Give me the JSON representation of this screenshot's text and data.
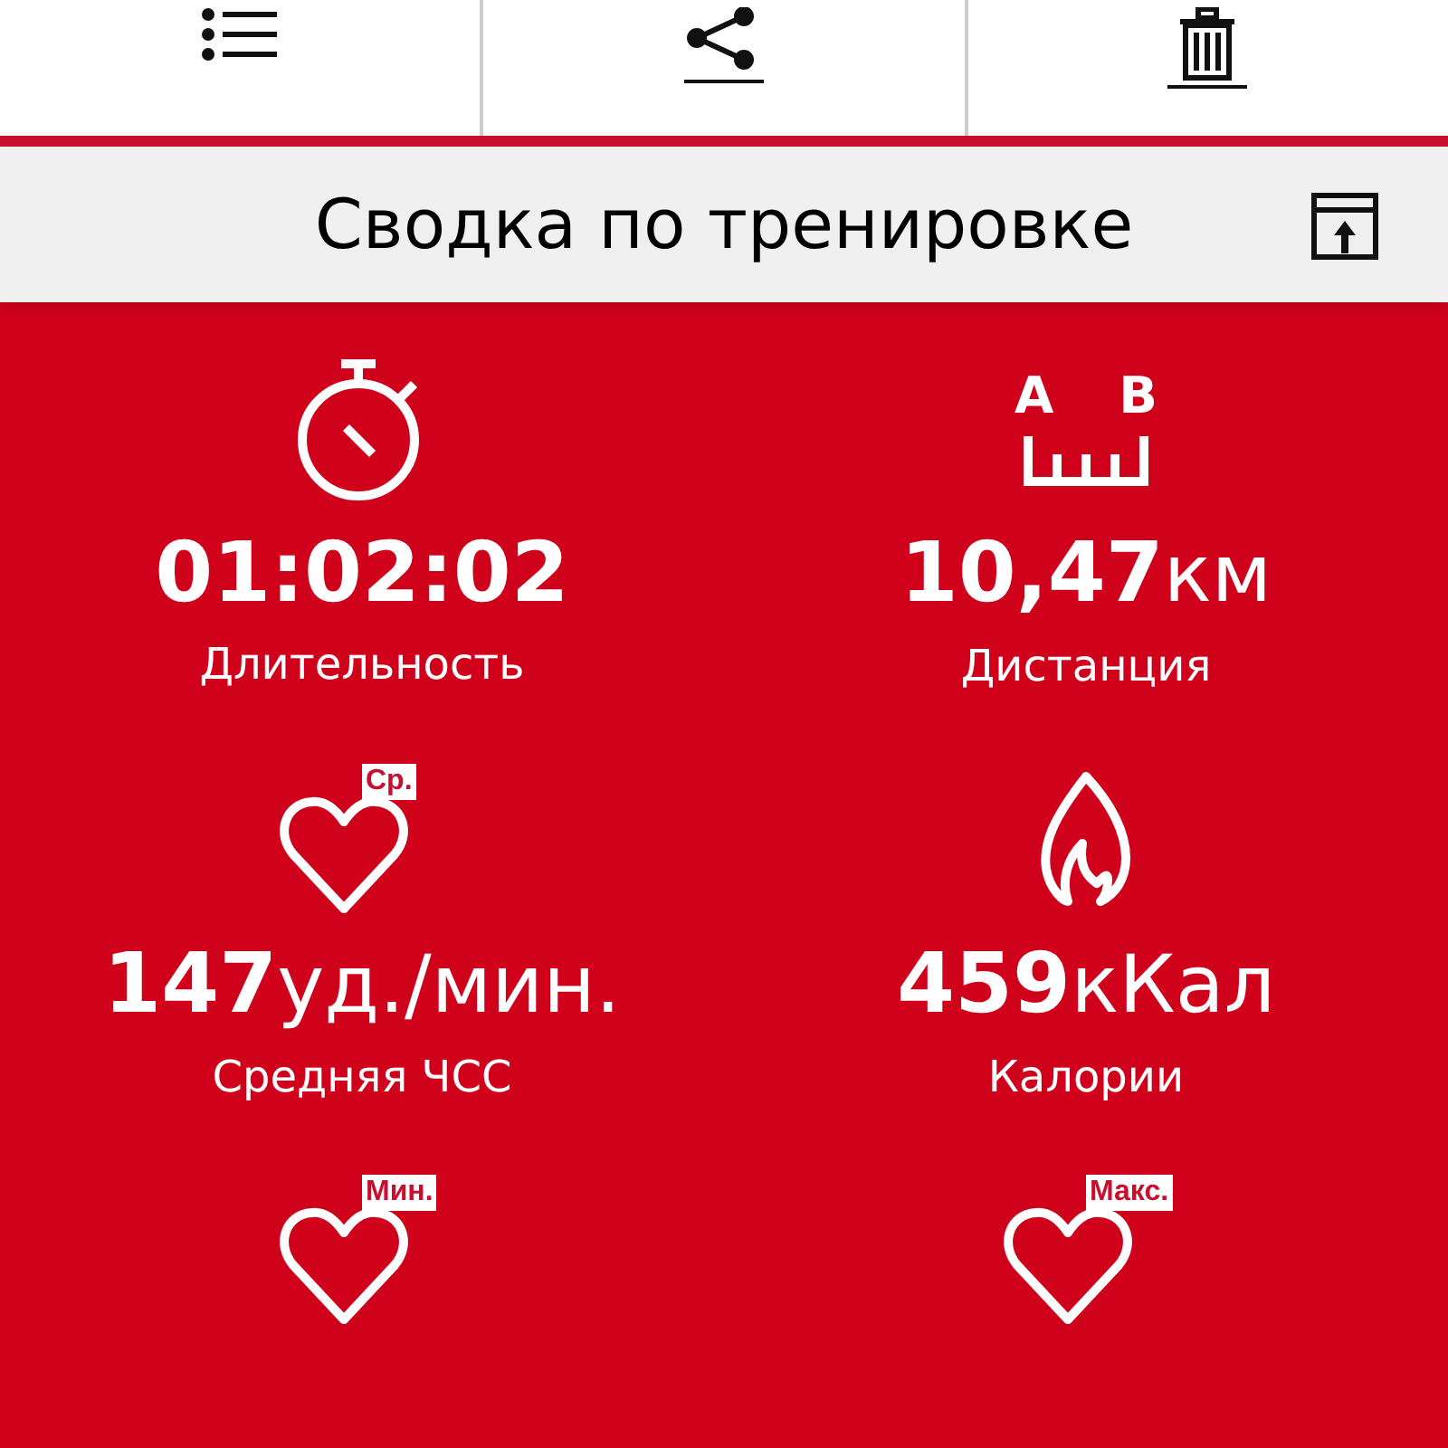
{
  "toolbar": [
    {
      "kind": "list"
    },
    {
      "kind": "share"
    },
    {
      "kind": "trash"
    }
  ],
  "header": {
    "title": "Сводка по тренировке"
  },
  "stats": [
    {
      "kind": "stopwatch",
      "value": "01:02:02",
      "label": "Длительность"
    },
    {
      "kind": "distance",
      "marks": [
        "A",
        "B"
      ],
      "value": "10,47",
      "unit": "км",
      "label": "Дистанция"
    },
    {
      "kind": "heart",
      "badge": "Ср.",
      "value": "147",
      "unit": "уд./мин.",
      "label": "Средняя ЧСС"
    },
    {
      "kind": "flame",
      "value": "459",
      "unit": "кКал",
      "label": "Калории"
    },
    {
      "kind": "heart",
      "badge": "Мин."
    },
    {
      "kind": "heart",
      "badge": "Макс."
    }
  ]
}
